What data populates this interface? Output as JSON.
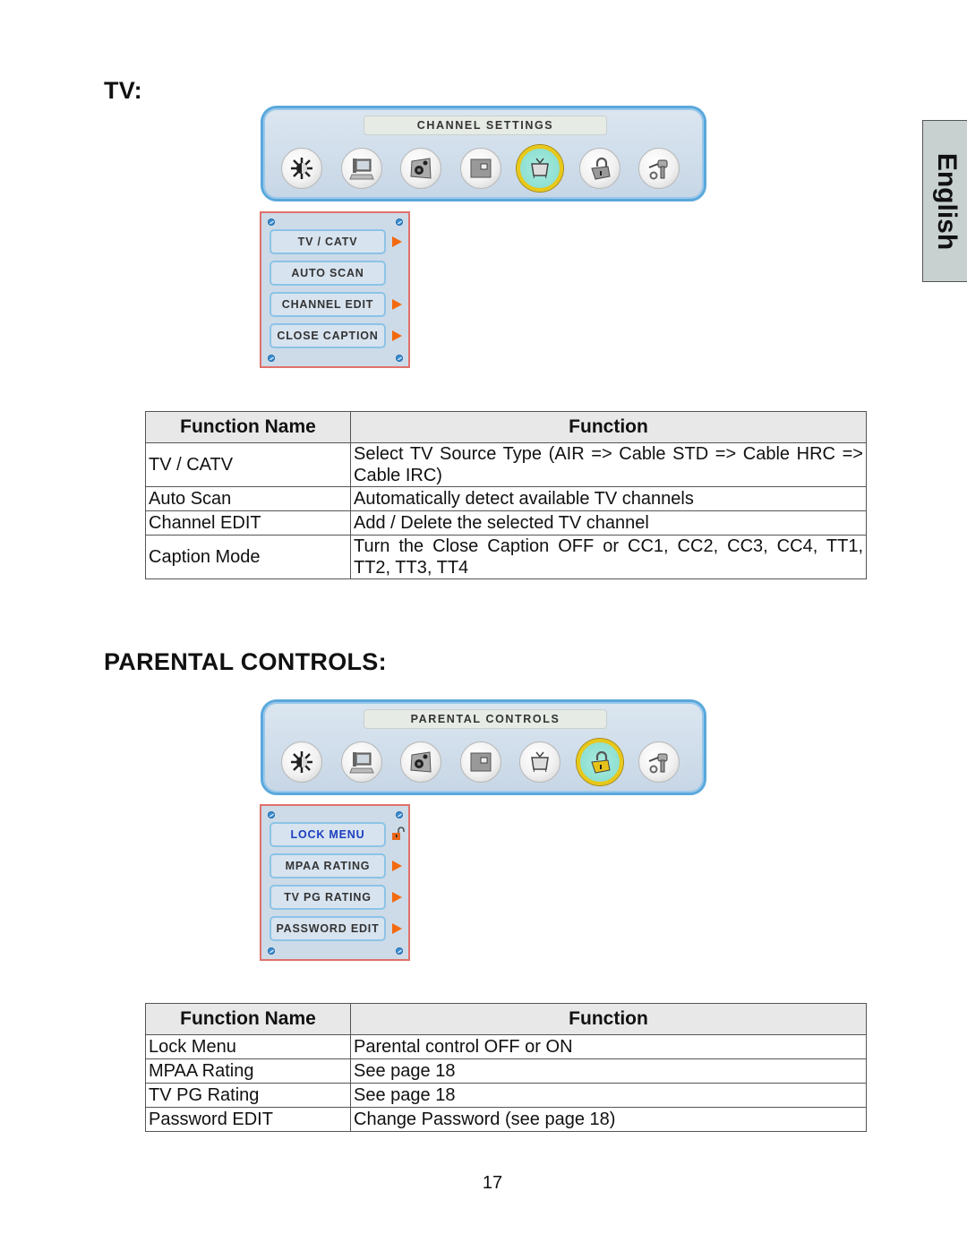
{
  "language_tab": "English",
  "sections": {
    "tv": {
      "heading": "TV:",
      "osd": {
        "title": "CHANNEL SETTINGS",
        "icons": [
          {
            "name": "picture-icon",
            "active": false
          },
          {
            "name": "pc-icon",
            "active": false
          },
          {
            "name": "audio-icon",
            "active": false
          },
          {
            "name": "window-icon",
            "active": false
          },
          {
            "name": "tv-icon",
            "active": true
          },
          {
            "name": "lock-icon",
            "active": false
          },
          {
            "name": "setup-tools-icon",
            "active": false
          }
        ]
      },
      "submenu": [
        {
          "label": "TV / CATV",
          "marker": "arrow"
        },
        {
          "label": "AUTO SCAN",
          "marker": "none"
        },
        {
          "label": "CHANNEL EDIT",
          "marker": "arrow"
        },
        {
          "label": "CLOSE CAPTION",
          "marker": "arrow"
        }
      ],
      "table": {
        "headers": [
          "Function Name",
          "Function"
        ],
        "rows": [
          [
            "TV / CATV",
            "Select TV Source Type (AIR => Cable STD => Cable HRC => Cable IRC)"
          ],
          [
            "Auto Scan",
            "Automatically detect available TV channels"
          ],
          [
            "Channel EDIT",
            "Add / Delete the selected TV channel"
          ],
          [
            "Caption Mode",
            "Turn the Close Caption OFF or CC1, CC2, CC3, CC4, TT1, TT2, TT3, TT4"
          ]
        ]
      }
    },
    "parental": {
      "heading": "PARENTAL CONTROLS:",
      "osd": {
        "title": "PARENTAL CONTROLS",
        "icons": [
          {
            "name": "picture-icon",
            "active": false
          },
          {
            "name": "pc-icon",
            "active": false
          },
          {
            "name": "audio-icon",
            "active": false
          },
          {
            "name": "window-icon",
            "active": false
          },
          {
            "name": "tv-icon",
            "active": false
          },
          {
            "name": "lock-icon",
            "active": true
          },
          {
            "name": "setup-tools-icon",
            "active": false
          }
        ]
      },
      "submenu": [
        {
          "label": "LOCK MENU",
          "marker": "lock",
          "highlight": true
        },
        {
          "label": "MPAA RATING",
          "marker": "arrow"
        },
        {
          "label": "TV PG RATING",
          "marker": "arrow"
        },
        {
          "label": "PASSWORD EDIT",
          "marker": "arrow"
        }
      ],
      "table": {
        "headers": [
          "Function Name",
          "Function"
        ],
        "rows": [
          [
            "Lock Menu",
            "Parental control OFF or ON"
          ],
          [
            "MPAA Rating",
            "See page 18"
          ],
          [
            "TV PG Rating",
            "See page 18"
          ],
          [
            "Password EDIT",
            "Change Password (see page 18)"
          ]
        ]
      }
    }
  },
  "colors": {
    "osd_border": "#5aa8dc",
    "active_ring": "#e8c81a",
    "submenu_border": "#e0706a",
    "arrow": "#f36a10",
    "highlight_text": "#1c3ec0"
  },
  "page_number": "17"
}
